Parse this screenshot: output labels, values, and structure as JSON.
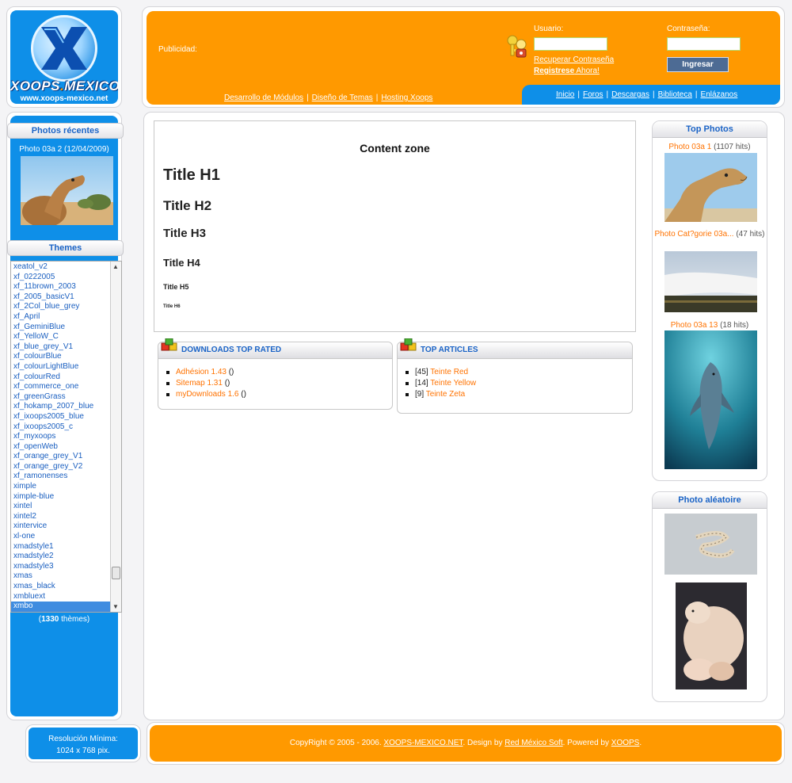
{
  "logo": {
    "name_part1": "XOOPS",
    "name_dot": ".",
    "name_part2": "MEXICO",
    "url": "www.xoops-mexico.net"
  },
  "header": {
    "publicity_label": "Publicidad:",
    "username_label": "Usuario:",
    "password_label": "Contraseña:",
    "recover_link": "Recuperar Contraseña",
    "register_bold": "Registrese",
    "register_rest": " Ahora!",
    "login_button": "Ingresar",
    "links_left": [
      "Desarrollo de Módulos",
      "Diseño de Temas",
      "Hosting Xoops"
    ],
    "nav": [
      "Inicio",
      "Foros",
      "Descargas",
      "Biblioteca",
      "Enlázanos"
    ],
    "separator": "|"
  },
  "left": {
    "recent_title": "Photos récentes",
    "recent_caption": "Photo 03a 2 (12/04/2009)",
    "themes_title": "Themes",
    "themes": [
      "xeatol_v2",
      "xf_0222005",
      "xf_11brown_2003",
      "xf_2005_basicV1",
      "xf_2Col_blue_grey",
      "xf_April",
      "xf_GeminiBlue",
      "xf_YelloW_C",
      "xf_blue_grey_V1",
      "xf_colourBlue",
      "xf_colourLightBlue",
      "xf_colourRed",
      "xf_commerce_one",
      "xf_greenGrass",
      "xf_hokamp_2007_blue",
      "xf_ixoops2005_blue",
      "xf_ixoops2005_c",
      "xf_myxoops",
      "xf_openWeb",
      "xf_orange_grey_V1",
      "xf_orange_grey_V2",
      "xf_ramonenses",
      "ximple",
      "ximple-blue",
      "xintel",
      "xintel2",
      "xintervice",
      "xl-one",
      "xmadstyle1",
      "xmadstyle2",
      "xmadstyle3",
      "xmas",
      "xmas_black",
      "xmbluext",
      "xmbo"
    ],
    "selected_theme": "xmbo",
    "themes_count": "1330",
    "themes_count_suffix": " thèmes)",
    "themes_count_prefix": "("
  },
  "center": {
    "content_zone_title": "Content zone",
    "h1": "Title H1",
    "h2": "Title H2",
    "h3": "Title H3",
    "h4": "Title H4",
    "h5": "Title H5",
    "h6": "Title H6",
    "downloads_title": "DOWNLOADS TOP RATED",
    "downloads": [
      {
        "name": "Adhésion 1.43",
        "suffix": " ()"
      },
      {
        "name": "Sitemap 1.31",
        "suffix": " ()"
      },
      {
        "name": "myDownloads 1.6",
        "suffix": " ()"
      }
    ],
    "articles_title": "TOP ARTICLES",
    "articles": [
      {
        "count": "[45] ",
        "name": "Teinte Red"
      },
      {
        "count": "[14] ",
        "name": "Teinte Yellow"
      },
      {
        "count": "[9] ",
        "name": "Teinte Zeta"
      }
    ]
  },
  "right": {
    "top_title": "Top Photos",
    "top_photos": [
      {
        "name": "Photo 03a 1",
        "hits": " (1107 hits)"
      },
      {
        "name": "Photo Cat?gorie 03a...",
        "hits": " (47 hits)"
      },
      {
        "name": "Photo 03a 13",
        "hits": " (18 hits)"
      }
    ],
    "random_title": "Photo aléatoire"
  },
  "footer": {
    "resolution_line1": "Resolución Mínima:",
    "resolution_line2": "1024 x 768 pix.",
    "copyright_text": "CopyRight © 2005 - 2006. ",
    "site_link": "XOOPS-MEXICO.NET",
    "design_by": ". Design by ",
    "designer_link": "Red México Soft",
    "powered_by": ". Powered by ",
    "xoops_link": "XOOPS",
    "end": "."
  },
  "colors": {
    "orange": "#ff9900",
    "blue": "#0e8fe8",
    "link": "#1a5fc0",
    "accent_orange": "#ff7200"
  }
}
